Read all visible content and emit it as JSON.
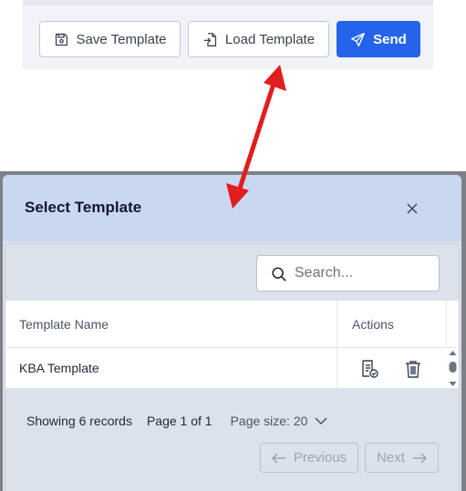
{
  "toolbar": {
    "save_label": "Save Template",
    "load_label": "Load Template",
    "send_label": "Send"
  },
  "modal": {
    "title": "Select Template",
    "search_placeholder": "Search...",
    "columns": [
      "Template Name",
      "Actions"
    ],
    "rows": [
      {
        "name": "KBA Template"
      }
    ],
    "footer": {
      "records": "Showing 6 records",
      "page": "Page 1 of 1",
      "page_size": "Page size: 20"
    },
    "pagination": {
      "previous_label": "Previous",
      "next_label": "Next"
    }
  },
  "colors": {
    "accent": "#2563eb",
    "annotation_arrow": "#e11d1d",
    "modal_header": "#c9d8f0"
  }
}
